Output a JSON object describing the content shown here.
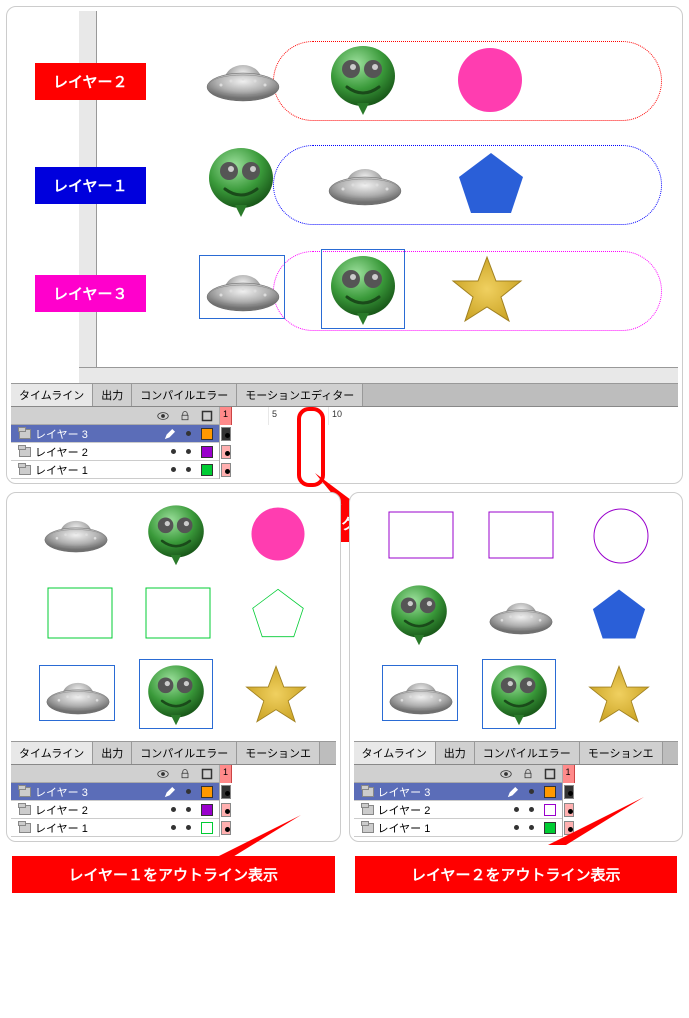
{
  "main": {
    "labels": {
      "layer2": "レイヤー２",
      "layer1": "レイヤー１",
      "layer3": "レイヤー３"
    },
    "timeline": {
      "tabs": [
        "タイムライン",
        "出力",
        "コンパイルエラー",
        "モーションエディター"
      ],
      "ticks": {
        "t1": "1",
        "t5": "5",
        "t10": "10"
      },
      "layers": [
        {
          "name": "レイヤー 3",
          "selected": true,
          "swatch": "#ff9900"
        },
        {
          "name": "レイヤー 2",
          "selected": false,
          "swatch": "#9900cc"
        },
        {
          "name": "レイヤー 1",
          "selected": false,
          "swatch": "#00cc33"
        }
      ]
    },
    "callout": "クリックでon/offできる"
  },
  "bottomLeft": {
    "timeline": {
      "tabs": [
        "タイムライン",
        "出力",
        "コンパイルエラー",
        "モーションエ"
      ],
      "layers": [
        {
          "name": "レイヤー 3",
          "selected": true,
          "swatch": "#ff9900",
          "outline": false
        },
        {
          "name": "レイヤー 2",
          "selected": false,
          "swatch": "#9900cc",
          "outline": false
        },
        {
          "name": "レイヤー 1",
          "selected": false,
          "swatch": "#00cc33",
          "outline": true
        }
      ]
    },
    "label": "レイヤー１をアウトライン表示"
  },
  "bottomRight": {
    "timeline": {
      "tabs": [
        "タイムライン",
        "出力",
        "コンパイルエラー",
        "モーションエ"
      ],
      "layers": [
        {
          "name": "レイヤー 3",
          "selected": true,
          "swatch": "#ff9900",
          "outline": false
        },
        {
          "name": "レイヤー 2",
          "selected": false,
          "swatch": "#9900cc",
          "outline": true
        },
        {
          "name": "レイヤー 1",
          "selected": false,
          "swatch": "#00cc33",
          "outline": false
        }
      ]
    },
    "label": "レイヤー２をアウトライン表示"
  }
}
